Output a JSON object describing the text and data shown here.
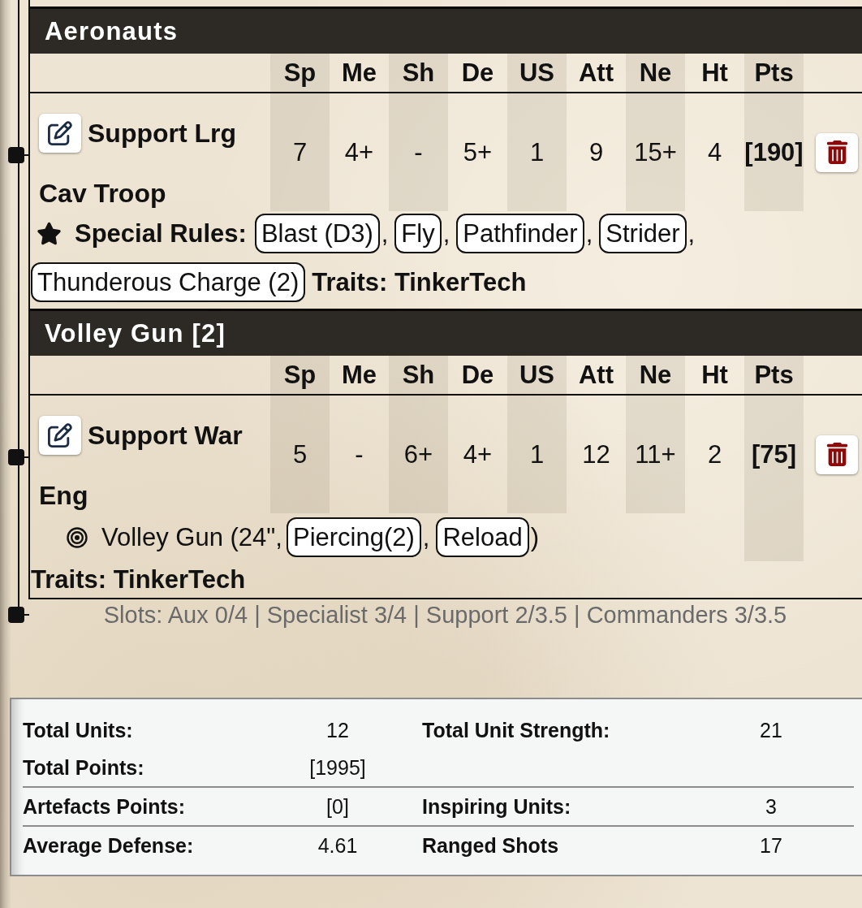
{
  "units": [
    {
      "title": "Aeronauts",
      "columns": [
        "Sp",
        "Me",
        "Sh",
        "De",
        "US",
        "Att",
        "Ne",
        "Ht",
        "Pts"
      ],
      "name": "Support Lrg",
      "type": "Cav Troop",
      "stats": [
        "7",
        "4+",
        "-",
        "5+",
        "1",
        "9",
        "15+",
        "4"
      ],
      "points": "[190]",
      "special_rules": {
        "label": "Special Rules:",
        "items": [
          "Blast (D3)",
          "Fly",
          "Pathfinder",
          "Strider",
          "Thunderous Charge (2)"
        ],
        "separator": ","
      },
      "traits": "Traits: TinkerTech"
    },
    {
      "title": "Volley Gun [2]",
      "columns": [
        "Sp",
        "Me",
        "Sh",
        "De",
        "US",
        "Att",
        "Ne",
        "Ht",
        "Pts"
      ],
      "name": "Support War",
      "type": "Eng",
      "stats": [
        "5",
        "-",
        "6+",
        "4+",
        "1",
        "12",
        "11+",
        "2"
      ],
      "points": "[75]",
      "weapons": [
        {
          "text": "Volley Gun (24\",",
          "rules": [
            "Piercing(2)",
            "Reload"
          ],
          "separator": ",",
          "close": ")"
        }
      ],
      "traits": "Traits: TinkerTech"
    }
  ],
  "slots": "Slots: Aux 0/4 | Specialist 3/4 | Support 2/3.5 | Commanders 3/3.5",
  "summary": {
    "groups": [
      {
        "rows": [
          [
            {
              "label": "Total Units:",
              "value": "12"
            },
            {
              "label": "Total Unit Strength:",
              "value": "21"
            }
          ],
          [
            {
              "label": "Total Points:",
              "value": "[1995]"
            }
          ]
        ]
      },
      {
        "rows": [
          [
            {
              "label": "Artefacts Points:",
              "value": "[0]"
            },
            {
              "label": "Inspiring Units:",
              "value": "3"
            }
          ]
        ]
      },
      {
        "rows": [
          [
            {
              "label": "Average Defense:",
              "value": "4.61"
            },
            {
              "label": "Ranged Shots",
              "value": "17"
            }
          ]
        ]
      }
    ]
  }
}
